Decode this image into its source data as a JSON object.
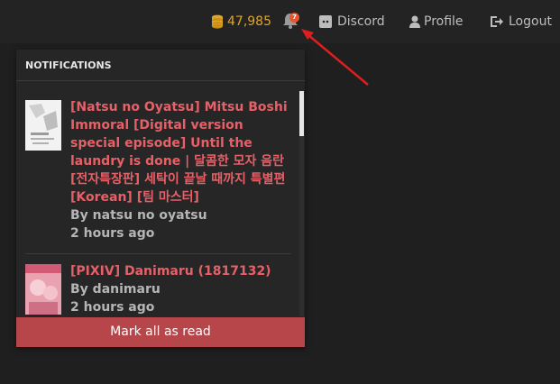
{
  "topbar": {
    "coins": "47,985",
    "notification_count": "7",
    "discord": "Discord",
    "profile": "Profile",
    "logout": "Logout"
  },
  "notifications": {
    "header": "NOTIFICATIONS",
    "items": [
      {
        "title": "[Natsu no Oyatsu] Mitsu Boshi Immoral [Digital version special episode] Until the laundry is done | 달콤한 모자 음란 [전자특장판] 세탁이 끝날 때까지 특별편 [Korean] [팀 마스터]",
        "author": "By natsu no oyatsu",
        "time": "2 hours ago"
      },
      {
        "title": "[PIXIV] Danimaru (1817132)",
        "author": "By danimaru",
        "time": "2 hours ago"
      }
    ],
    "mark_all": "Mark all as read"
  },
  "colors": {
    "accent": "#b64649",
    "title": "#e66068",
    "coin": "#e1a623",
    "badge": "#e9542d"
  }
}
